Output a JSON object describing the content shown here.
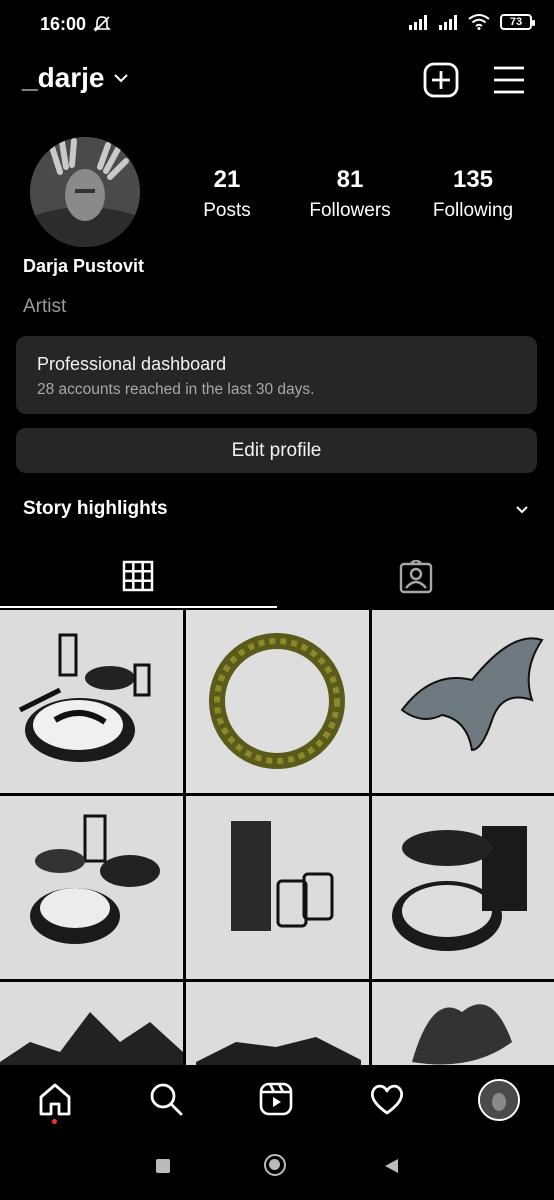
{
  "status_bar": {
    "time": "16:00",
    "battery": "73"
  },
  "header": {
    "username": "_darje"
  },
  "profile": {
    "stats": [
      {
        "value": "21",
        "label": "Posts"
      },
      {
        "value": "81",
        "label": "Followers"
      },
      {
        "value": "135",
        "label": "Following"
      }
    ],
    "name": "Darja Pustovit",
    "bio": "Artist"
  },
  "dashboard": {
    "title": "Professional dashboard",
    "subtitle": "28 accounts reached in the last 30 days."
  },
  "edit_profile": "Edit profile",
  "highlights": {
    "label": "Story highlights"
  },
  "tabs": [
    "grid-icon",
    "tagged-icon"
  ],
  "nav": [
    "home-icon",
    "search-icon",
    "reels-icon",
    "heart-icon",
    "profile-avatar"
  ],
  "colors": {
    "background": "#000000",
    "card": "#262626",
    "muted_text": "#9a9a9a",
    "notification": "#ff3040"
  }
}
